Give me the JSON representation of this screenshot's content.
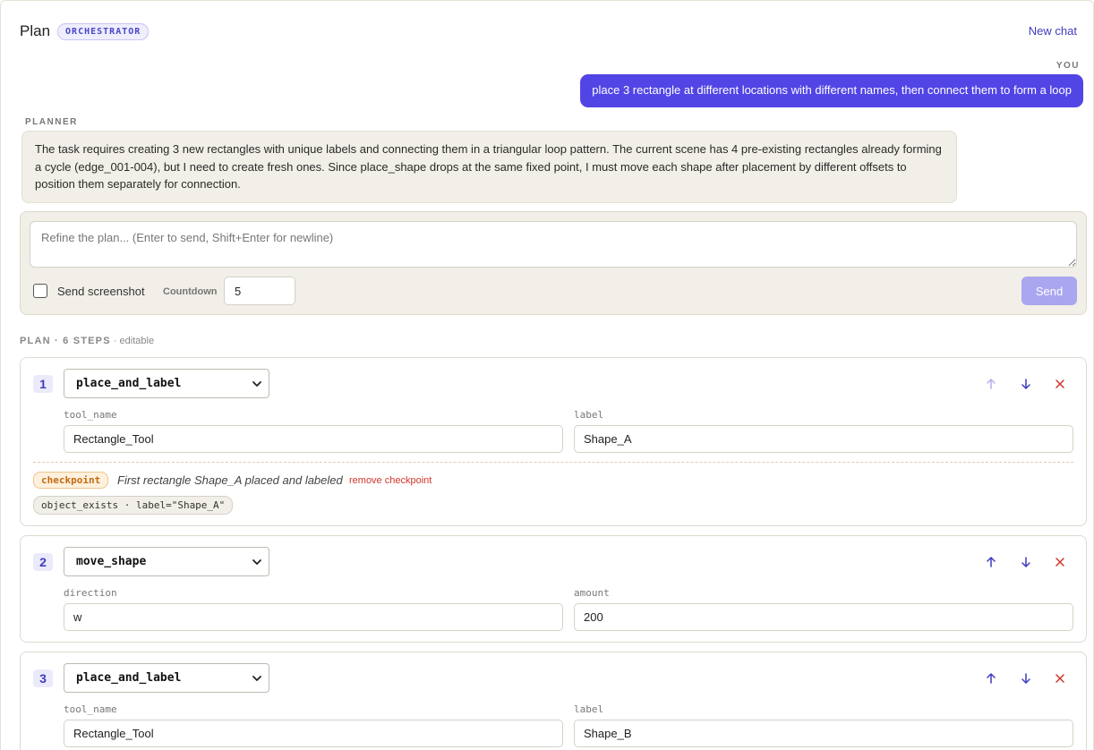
{
  "header": {
    "title": "Plan",
    "badge": "ORCHESTRATOR",
    "new_chat": "New chat"
  },
  "user_message": {
    "label": "YOU",
    "text": "place 3 rectangle at different locations with different names, then connect them to form a loop"
  },
  "planner_message": {
    "label": "PLANNER",
    "text": "The task requires creating 3 new rectangles with unique labels and connecting them in a triangular loop pattern. The current scene has 4 pre-existing rectangles already forming a cycle (edge_001-004), but I need to create fresh ones. Since place_shape drops at the same fixed point, I must move each shape after placement by different offsets to position them separately for connection."
  },
  "composer": {
    "placeholder": "Refine the plan... (Enter to send, Shift+Enter for newline)",
    "send_screenshot_label": "Send screenshot",
    "send_screenshot_checked": false,
    "countdown_label": "Countdown",
    "countdown_value": "5",
    "send_label": "Send"
  },
  "plan": {
    "heading": "PLAN · 6 STEPS",
    "editable": " · editable",
    "steps": [
      {
        "number": "1",
        "action": "place_and_label",
        "fields": [
          {
            "name": "tool_name",
            "value": "Rectangle_Tool"
          },
          {
            "name": "label",
            "value": "Shape_A"
          }
        ],
        "checkpoint": {
          "badge": "checkpoint",
          "text": "First rectangle Shape_A placed and labeled",
          "remove": "remove checkpoint",
          "condition": "object_exists · label=\"Shape_A\""
        }
      },
      {
        "number": "2",
        "action": "move_shape",
        "fields": [
          {
            "name": "direction",
            "value": "w"
          },
          {
            "name": "amount",
            "value": "200"
          }
        ]
      },
      {
        "number": "3",
        "action": "place_and_label",
        "fields": [
          {
            "name": "tool_name",
            "value": "Rectangle_Tool"
          },
          {
            "name": "label",
            "value": "Shape_B"
          }
        ]
      }
    ]
  },
  "icons": {
    "move_up": "arrow-up-icon",
    "move_down": "arrow-down-icon",
    "remove": "close-icon",
    "dropdown": "chevron-down-icon"
  },
  "colors": {
    "accent": "#5145e5",
    "accent_text": "#3f3cbf",
    "danger": "#d0352c",
    "checkpoint": "#c46a10",
    "panel_bg": "#f1efe7",
    "send_disabled": "#aaa6ef"
  }
}
